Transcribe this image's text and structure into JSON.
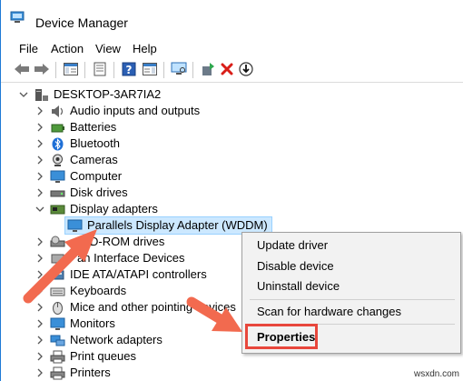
{
  "window": {
    "title": "Device Manager"
  },
  "menu": [
    "File",
    "Action",
    "View",
    "Help"
  ],
  "toolbar": {
    "buttons": [
      "back-icon",
      "forward-icon",
      "show-hide-console-tree-icon",
      "properties-icon",
      "help-icon",
      "action-pane-icon",
      "scan-monitor-icon",
      "update-driver-icon",
      "uninstall-device-icon",
      "disable-device-icon"
    ]
  },
  "tree": {
    "root": "DESKTOP-3AR7IA2",
    "items": [
      {
        "label": "Audio inputs and outputs",
        "icon": "speaker-icon"
      },
      {
        "label": "Batteries",
        "icon": "battery-icon"
      },
      {
        "label": "Bluetooth",
        "icon": "bluetooth-icon"
      },
      {
        "label": "Cameras",
        "icon": "camera-icon"
      },
      {
        "label": "Computer",
        "icon": "computer-icon"
      },
      {
        "label": "Disk drives",
        "icon": "disk-icon"
      },
      {
        "label": "Display adapters",
        "icon": "display-adapter-icon",
        "expanded": true
      },
      {
        "label": "Parallels Display Adapter (WDDM)",
        "icon": "monitor-icon",
        "child": true,
        "selected": true
      },
      {
        "label": "DVD/CD-ROM drives",
        "icon": "dvd-icon"
      },
      {
        "label": "Human Interface Devices",
        "icon": "hid-icon"
      },
      {
        "label": "IDE ATA/ATAPI controllers",
        "icon": "ide-icon"
      },
      {
        "label": "Keyboards",
        "icon": "keyboard-icon"
      },
      {
        "label": "Mice and other pointing devices",
        "icon": "mouse-icon"
      },
      {
        "label": "Monitors",
        "icon": "monitor-icon"
      },
      {
        "label": "Network adapters",
        "icon": "network-icon"
      },
      {
        "label": "Print queues",
        "icon": "printer-icon"
      },
      {
        "label": "Printers",
        "icon": "printer-icon"
      }
    ],
    "visible_labels": {
      "dvd": "D-ROM drives",
      "hid": "an Interface Devices",
      "ide": "IDE ATA/ATAPI controllers",
      "mice": "Mice and other pointing devices"
    }
  },
  "context_menu": {
    "items": [
      "Update driver",
      "Disable device",
      "Uninstall device",
      "Scan for hardware changes",
      "Properties"
    ],
    "highlight_color": "#e8473c"
  },
  "arrow_color": "#f26a4f",
  "watermark": "wsxdn.com"
}
